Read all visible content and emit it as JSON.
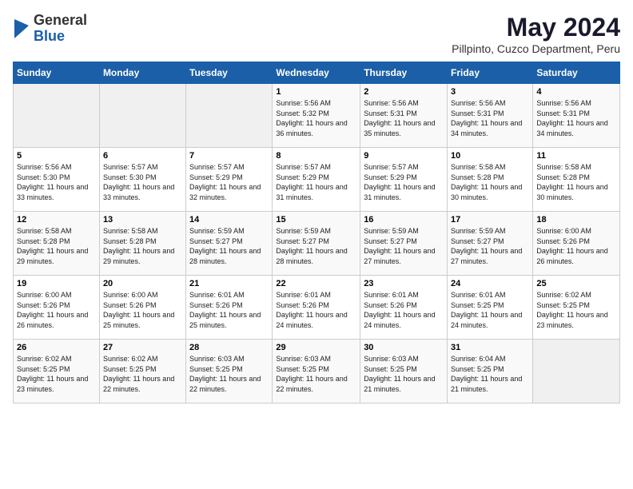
{
  "logo": {
    "general": "General",
    "blue": "Blue"
  },
  "header": {
    "month": "May 2024",
    "location": "Pillpinto, Cuzco Department, Peru"
  },
  "days_of_week": [
    "Sunday",
    "Monday",
    "Tuesday",
    "Wednesday",
    "Thursday",
    "Friday",
    "Saturday"
  ],
  "weeks": [
    [
      {
        "day": "",
        "empty": true
      },
      {
        "day": "",
        "empty": true
      },
      {
        "day": "",
        "empty": true
      },
      {
        "day": "1",
        "sunrise": "5:56 AM",
        "sunset": "5:32 PM",
        "daylight": "11 hours and 36 minutes."
      },
      {
        "day": "2",
        "sunrise": "5:56 AM",
        "sunset": "5:31 PM",
        "daylight": "11 hours and 35 minutes."
      },
      {
        "day": "3",
        "sunrise": "5:56 AM",
        "sunset": "5:31 PM",
        "daylight": "11 hours and 34 minutes."
      },
      {
        "day": "4",
        "sunrise": "5:56 AM",
        "sunset": "5:31 PM",
        "daylight": "11 hours and 34 minutes."
      }
    ],
    [
      {
        "day": "5",
        "sunrise": "5:56 AM",
        "sunset": "5:30 PM",
        "daylight": "11 hours and 33 minutes."
      },
      {
        "day": "6",
        "sunrise": "5:57 AM",
        "sunset": "5:30 PM",
        "daylight": "11 hours and 33 minutes."
      },
      {
        "day": "7",
        "sunrise": "5:57 AM",
        "sunset": "5:29 PM",
        "daylight": "11 hours and 32 minutes."
      },
      {
        "day": "8",
        "sunrise": "5:57 AM",
        "sunset": "5:29 PM",
        "daylight": "11 hours and 31 minutes."
      },
      {
        "day": "9",
        "sunrise": "5:57 AM",
        "sunset": "5:29 PM",
        "daylight": "11 hours and 31 minutes."
      },
      {
        "day": "10",
        "sunrise": "5:58 AM",
        "sunset": "5:28 PM",
        "daylight": "11 hours and 30 minutes."
      },
      {
        "day": "11",
        "sunrise": "5:58 AM",
        "sunset": "5:28 PM",
        "daylight": "11 hours and 30 minutes."
      }
    ],
    [
      {
        "day": "12",
        "sunrise": "5:58 AM",
        "sunset": "5:28 PM",
        "daylight": "11 hours and 29 minutes."
      },
      {
        "day": "13",
        "sunrise": "5:58 AM",
        "sunset": "5:28 PM",
        "daylight": "11 hours and 29 minutes."
      },
      {
        "day": "14",
        "sunrise": "5:59 AM",
        "sunset": "5:27 PM",
        "daylight": "11 hours and 28 minutes."
      },
      {
        "day": "15",
        "sunrise": "5:59 AM",
        "sunset": "5:27 PM",
        "daylight": "11 hours and 28 minutes."
      },
      {
        "day": "16",
        "sunrise": "5:59 AM",
        "sunset": "5:27 PM",
        "daylight": "11 hours and 27 minutes."
      },
      {
        "day": "17",
        "sunrise": "5:59 AM",
        "sunset": "5:27 PM",
        "daylight": "11 hours and 27 minutes."
      },
      {
        "day": "18",
        "sunrise": "6:00 AM",
        "sunset": "5:26 PM",
        "daylight": "11 hours and 26 minutes."
      }
    ],
    [
      {
        "day": "19",
        "sunrise": "6:00 AM",
        "sunset": "5:26 PM",
        "daylight": "11 hours and 26 minutes."
      },
      {
        "day": "20",
        "sunrise": "6:00 AM",
        "sunset": "5:26 PM",
        "daylight": "11 hours and 25 minutes."
      },
      {
        "day": "21",
        "sunrise": "6:01 AM",
        "sunset": "5:26 PM",
        "daylight": "11 hours and 25 minutes."
      },
      {
        "day": "22",
        "sunrise": "6:01 AM",
        "sunset": "5:26 PM",
        "daylight": "11 hours and 24 minutes."
      },
      {
        "day": "23",
        "sunrise": "6:01 AM",
        "sunset": "5:26 PM",
        "daylight": "11 hours and 24 minutes."
      },
      {
        "day": "24",
        "sunrise": "6:01 AM",
        "sunset": "5:25 PM",
        "daylight": "11 hours and 24 minutes."
      },
      {
        "day": "25",
        "sunrise": "6:02 AM",
        "sunset": "5:25 PM",
        "daylight": "11 hours and 23 minutes."
      }
    ],
    [
      {
        "day": "26",
        "sunrise": "6:02 AM",
        "sunset": "5:25 PM",
        "daylight": "11 hours and 23 minutes."
      },
      {
        "day": "27",
        "sunrise": "6:02 AM",
        "sunset": "5:25 PM",
        "daylight": "11 hours and 22 minutes."
      },
      {
        "day": "28",
        "sunrise": "6:03 AM",
        "sunset": "5:25 PM",
        "daylight": "11 hours and 22 minutes."
      },
      {
        "day": "29",
        "sunrise": "6:03 AM",
        "sunset": "5:25 PM",
        "daylight": "11 hours and 22 minutes."
      },
      {
        "day": "30",
        "sunrise": "6:03 AM",
        "sunset": "5:25 PM",
        "daylight": "11 hours and 21 minutes."
      },
      {
        "day": "31",
        "sunrise": "6:04 AM",
        "sunset": "5:25 PM",
        "daylight": "11 hours and 21 minutes."
      },
      {
        "day": "",
        "empty": true
      }
    ]
  ],
  "labels": {
    "sunrise_prefix": "Sunrise: ",
    "sunset_prefix": "Sunset: ",
    "daylight_prefix": "Daylight: "
  }
}
